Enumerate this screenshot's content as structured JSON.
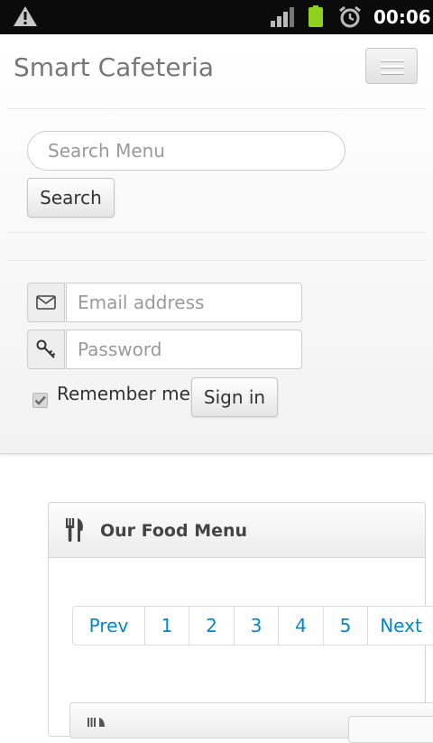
{
  "status_bar": {
    "time": "00:06",
    "icons": [
      "warning-icon",
      "signal-icon",
      "battery-icon",
      "alarm-clock-icon"
    ]
  },
  "navbar": {
    "brand": "Smart Cafeteria",
    "toggle_icon": "menu-icon"
  },
  "search": {
    "placeholder": "Search Menu",
    "button_label": "Search"
  },
  "login": {
    "email_placeholder": "Email address",
    "password_placeholder": "Password",
    "remember_label": "Remember me",
    "remember_checked": true,
    "signin_label": "Sign in",
    "email_icon": "envelope-icon",
    "password_icon": "key-icon"
  },
  "food_menu": {
    "title": "Our Food Menu",
    "icon": "cutlery-icon",
    "pagination": [
      "Prev",
      "1",
      "2",
      "3",
      "4",
      "5",
      "Next"
    ]
  },
  "colors": {
    "link": "#0088cc",
    "brand_text": "#777777",
    "status_bar": "#0b0b0b",
    "battery": "#8fd11d"
  }
}
